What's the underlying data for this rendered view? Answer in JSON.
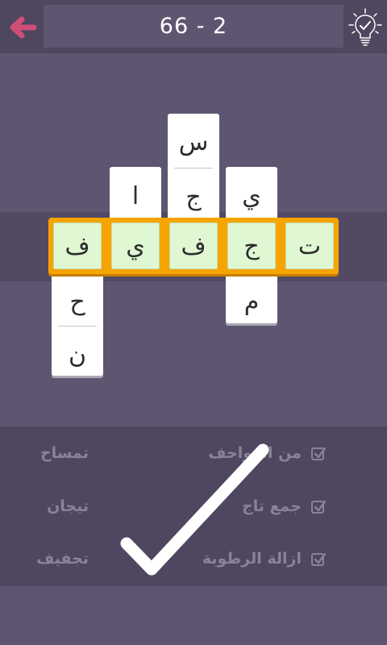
{
  "header": {
    "level": "66 - 2",
    "back_icon": "back-arrow-icon",
    "hint_icon": "lightbulb-check-icon",
    "back_color": "#cf4e78"
  },
  "board": {
    "row_word_letters": [
      "ف",
      "ي",
      "ف",
      "ج",
      "ت"
    ],
    "columns": [
      {
        "above": [],
        "below": [
          "ح",
          "ن"
        ]
      },
      {
        "above": [
          "ا"
        ],
        "below": []
      },
      {
        "above": [
          "س",
          "ج"
        ],
        "below": []
      },
      {
        "above": [
          "ي"
        ],
        "below": [
          "م"
        ]
      },
      {
        "above": [],
        "below": []
      }
    ],
    "highlight_color": "#f6a400",
    "cell_color": "#dff7d3"
  },
  "clues": {
    "right": [
      {
        "text": "من الزواحف",
        "checked": true
      },
      {
        "text": "جمع تاج",
        "checked": true
      },
      {
        "text": "ازالة الرطوبة",
        "checked": true
      }
    ],
    "left": [
      "تمساح",
      "تيجان",
      "تجفيف"
    ]
  },
  "overlay": {
    "icon": "large-checkmark-icon"
  }
}
